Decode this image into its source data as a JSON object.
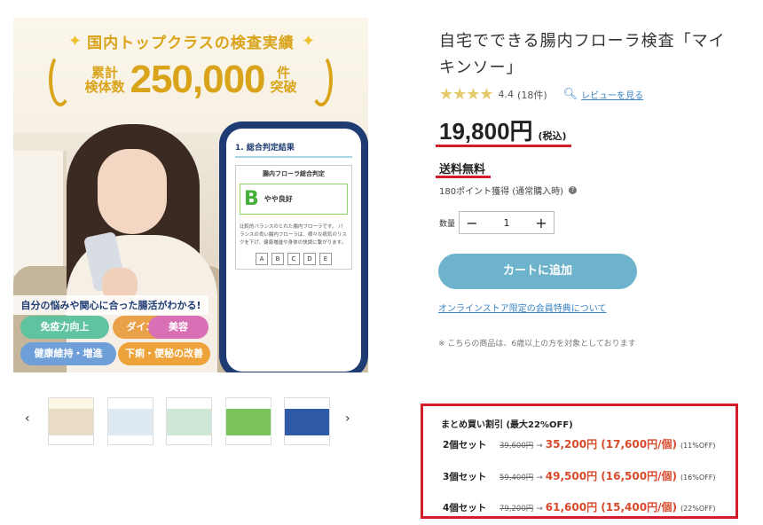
{
  "hero": {
    "headline_line1": "国内トップクラスの検査実績",
    "headline_small_a": "累計",
    "headline_small_b": "検体数",
    "headline_big": "250,000",
    "headline_suffix_a": "件",
    "headline_suffix_b": "突破",
    "concern_text": "自分の悩みや関心に合った腸活がわかる!",
    "tags": [
      {
        "label": "免疫力向上",
        "color": "#5fc3a0"
      },
      {
        "label": "ダイエット",
        "color": "#e9a14a"
      },
      {
        "label": "美容",
        "color": "#d96fb4"
      },
      {
        "label": "健康維持・増進",
        "color": "#6f9fd8"
      },
      {
        "label": "下痢・便秘の改善",
        "color": "#eea33a"
      }
    ],
    "phone": {
      "title": "1. 総合判定結果",
      "card_title": "腸内フローラ総合判定",
      "grade": "B",
      "grade_label": "やや良好",
      "text": "比較的バランスのとれた腸内フローラです。 バランスの良い腸内フローラは、様々な病気のリスクを下げ、健康増進や身体の快調に繋がります。",
      "abc": [
        "A",
        "B",
        "C",
        "D",
        "E"
      ]
    }
  },
  "thumbnails": {
    "prev_label": "‹",
    "next_label": "›",
    "items": [
      {
        "top": "#fdf7e6",
        "mid": "#e9dcc4"
      },
      {
        "top": "#ffffff",
        "mid": "#dfe9f2"
      },
      {
        "top": "#ffffff",
        "mid": "#cfe7d6"
      },
      {
        "top": "#ffffff",
        "mid": "#7cc35c"
      },
      {
        "top": "#ffffff",
        "mid": "#2f5aa8"
      }
    ]
  },
  "product": {
    "title": "自宅でできる腸内フローラ検査「マイキンソー」",
    "stars": "★★★★",
    "score": "4.4",
    "review_count": "(18件)",
    "review_link": "レビューを見る",
    "price": "19,800円",
    "tax": "(税込)",
    "shipping": "送料無料",
    "points": "180ポイント獲得 (通常購入時)",
    "qty_label": "数量",
    "qty_minus": "−",
    "qty_value": "1",
    "qty_plus": "+",
    "cart_button": "カートに追加",
    "member_link": "オンラインストア限定の会員特典について",
    "note": "※ こちらの商品は、6歳以上の方を対象としております"
  },
  "bulk": {
    "title": "まとめ買い割引 (最大22%OFF)",
    "rows": [
      {
        "set": "2個セット",
        "old": "39,600円",
        "arrow": "→",
        "new": "35,200円 (17,600円/個)",
        "off": "(11%OFF)"
      },
      {
        "set": "3個セット",
        "old": "59,400円",
        "arrow": "→",
        "new": "49,500円 (16,500円/個)",
        "off": "(16%OFF)"
      },
      {
        "set": "4個セット",
        "old": "79,200円",
        "arrow": "→",
        "new": "61,600円 (15,400円/個)",
        "off": "(22%OFF)"
      }
    ]
  },
  "colors": {
    "accent_red": "#d21e2a",
    "cart_blue": "#6db3cc",
    "link_blue": "#3a84c5",
    "gold": "#d9a31a"
  }
}
